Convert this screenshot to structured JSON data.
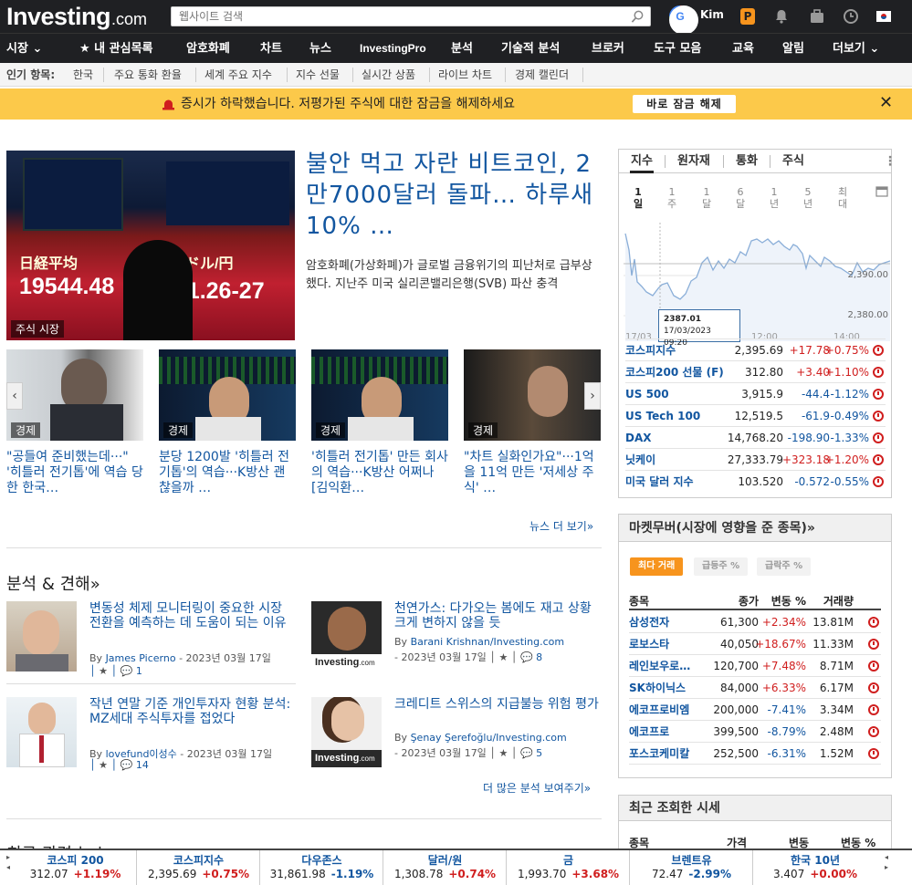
{
  "header": {
    "logo_main": "Investing",
    "logo_dot": ".com",
    "search_placeholder": "웹사이트 검색",
    "user_name": "Kim",
    "pro_letter": "P"
  },
  "nav": [
    "시장",
    "★ 내 관심목록",
    "암호화폐",
    "차트",
    "뉴스",
    "InvestingPro",
    "분석",
    "기술적 분석",
    "브로커",
    "도구 모음",
    "교육",
    "알림",
    "더보기"
  ],
  "subnav": {
    "label": "인기 항목:",
    "items": [
      "한국",
      "주요 통화 환율",
      "세계 주요 지수",
      "지수 선물",
      "실시간 상품",
      "라이브 차트",
      "경제 캘린더"
    ]
  },
  "banner": {
    "text": "증시가 하락했습니다. 저평가된 주식에 대한 잠금을 해제하세요",
    "button": "바로 잠금 해제",
    "close": "✕"
  },
  "hero": {
    "image_caption": "주식 시장",
    "board_numbers": [
      "19544.48",
      "121.26-27",
      "日経平均",
      "ドル/円"
    ],
    "title": "불안 먹고 자란 비트코인, 2만7000달러 돌파… 하루새 10% …",
    "description": "암호화폐(가상화폐)가 글로벌 금융위기의 피난처로 급부상했다. 지난주 미국 실리콘밸리은행(SVB) 파산 충격"
  },
  "carousel": [
    {
      "tag": "경제",
      "title": "\"공들여 준비했는데···\" '히틀러 전기톱'에 역습 당한 한국…"
    },
    {
      "tag": "경제",
      "title": "분당 1200발 '히틀러 전기톱'의 역습···K방산 괜찮을까 …"
    },
    {
      "tag": "경제",
      "title": "'히틀러 전기톱' 만든 회사의 역습···K방산 어쩌나 [김익환…"
    },
    {
      "tag": "경제",
      "title": "\"차트 실화인가요\"···1억을 11억 만든 '저세상 주식' …"
    }
  ],
  "more_news": "뉴스 더 보기»",
  "analysis": {
    "section_title": "분석 & 견해»",
    "items": [
      {
        "title": "변동성 체제 모니터링이 중요한 시장 전환을 예측하는 데 도움이 되는 이유",
        "by": "By",
        "author": "James Picerno",
        "date": "- 2023년 03월 17일",
        "comments": "1"
      },
      {
        "title": "천연가스: 다가오는 봄에도 재고 상황 크게 변하지 않을 듯",
        "by": "By",
        "author": "Barani Krishnan/Investing.com",
        "date": "- 2023년 03월 17일",
        "comments": "8"
      },
      {
        "title": "작년 연말 기준 개인투자자 현황 분석: MZ세대 주식투자를 접었다",
        "by": "By",
        "author": "lovefund이성수",
        "date": "- 2023년 03월 17일",
        "comments": "14"
      },
      {
        "title": "크레디트 스위스의 지급불능 위험 평가",
        "by": "By",
        "author": "Şenay Şerefoğlu/Investing.com",
        "date": "- 2023년 03월 17일",
        "comments": "5"
      }
    ],
    "logo_text": "Investing",
    "logo_dot": ".com",
    "more": "더 많은 분석 보여주기»"
  },
  "indices_panel": {
    "tabs": [
      "지수",
      "원자재",
      "통화",
      "주식"
    ],
    "periods": [
      "1일",
      "1주",
      "1달",
      "6달",
      "1년",
      "5년",
      "최대"
    ],
    "chart": {
      "y_labels": [
        "2,390.00",
        "2,380.00"
      ],
      "x_labels": [
        "17/03",
        "12:00",
        "14:00"
      ],
      "tooltip_value": "2387.01",
      "tooltip_time": "17/03/2023 09:20"
    },
    "rows": [
      {
        "name": "코스피지수",
        "price": "2,395.69",
        "change": "+17.78",
        "pct": "+0.75%",
        "dir": "pos"
      },
      {
        "name": "코스피200 선물 (F)",
        "price": "312.80",
        "change": "+3.40",
        "pct": "+1.10%",
        "dir": "pos"
      },
      {
        "name": "US 500",
        "price": "3,915.9",
        "change": "-44.4",
        "pct": "-1.12%",
        "dir": "neg"
      },
      {
        "name": "US Tech 100",
        "price": "12,519.5",
        "change": "-61.9",
        "pct": "-0.49%",
        "dir": "neg"
      },
      {
        "name": "DAX",
        "price": "14,768.20",
        "change": "-198.90",
        "pct": "-1.33%",
        "dir": "neg"
      },
      {
        "name": "닛케이",
        "price": "27,333.79",
        "change": "+323.18",
        "pct": "+1.20%",
        "dir": "pos"
      },
      {
        "name": "미국 달러 지수",
        "price": "103.520",
        "change": "-0.572",
        "pct": "-0.55%",
        "dir": "neg"
      }
    ]
  },
  "market_movers": {
    "title": "마켓무버(시장에 영향을 준 종목)»",
    "pills": [
      "최다 거래",
      "급등주 %",
      "급락주 %"
    ],
    "headers": [
      "종목",
      "종가",
      "변동 %",
      "거래량"
    ],
    "rows": [
      {
        "name": "삼성전자",
        "price": "61,300",
        "pct": "+2.34%",
        "vol": "13.81M",
        "dir": "pos"
      },
      {
        "name": "로보스타",
        "price": "40,050",
        "pct": "+18.67%",
        "vol": "11.33M",
        "dir": "pos"
      },
      {
        "name": "레인보우로…",
        "price": "120,700",
        "pct": "+7.48%",
        "vol": "8.71M",
        "dir": "pos"
      },
      {
        "name": "SK하이닉스",
        "price": "84,000",
        "pct": "+6.33%",
        "vol": "6.17M",
        "dir": "pos"
      },
      {
        "name": "에코프로비엠",
        "price": "200,000",
        "pct": "-7.41%",
        "vol": "3.34M",
        "dir": "neg"
      },
      {
        "name": "에코프로",
        "price": "399,500",
        "pct": "-8.79%",
        "vol": "2.48M",
        "dir": "neg"
      },
      {
        "name": "포스코케미칼",
        "price": "252,500",
        "pct": "-6.31%",
        "vol": "1.52M",
        "dir": "neg"
      }
    ]
  },
  "recent": {
    "title": "최근 조회한 시세",
    "headers": [
      "종목",
      "가격",
      "변동",
      "변동 %"
    ]
  },
  "bottom_hidden_heading": "최근 관련 뉴스",
  "ticker": [
    {
      "name": "코스피 200",
      "value": "312.07",
      "pct": "+1.19%",
      "dir": "pos"
    },
    {
      "name": "코스피지수",
      "value": "2,395.69",
      "pct": "+0.75%",
      "dir": "pos"
    },
    {
      "name": "다우존스",
      "value": "31,861.98",
      "pct": "-1.19%",
      "dir": "neg"
    },
    {
      "name": "달러/원",
      "value": "1,308.78",
      "pct": "+0.74%",
      "dir": "pos"
    },
    {
      "name": "금",
      "value": "1,993.70",
      "pct": "+3.68%",
      "dir": "pos"
    },
    {
      "name": "브렌트유",
      "value": "72.47",
      "pct": "-2.99%",
      "dir": "neg"
    },
    {
      "name": "한국 10년",
      "value": "3.407",
      "pct": "+0.00%",
      "dir": "pos"
    }
  ],
  "colors": {
    "accent": "#1256a0",
    "positive": "#d01e1e",
    "negative": "#1256a0",
    "banner": "#fcc94a",
    "topbar": "#1f2023",
    "pill_active": "#f7941d"
  },
  "icons": [
    "search-icon",
    "google-icon",
    "pro-icon",
    "bell-icon",
    "briefcase-icon",
    "clock-icon",
    "flag-kr-icon",
    "alarm-bell-icon",
    "chevron-left-icon",
    "chevron-right-icon",
    "comment-icon",
    "star-icon",
    "more-dots-icon",
    "expand-icon"
  ]
}
